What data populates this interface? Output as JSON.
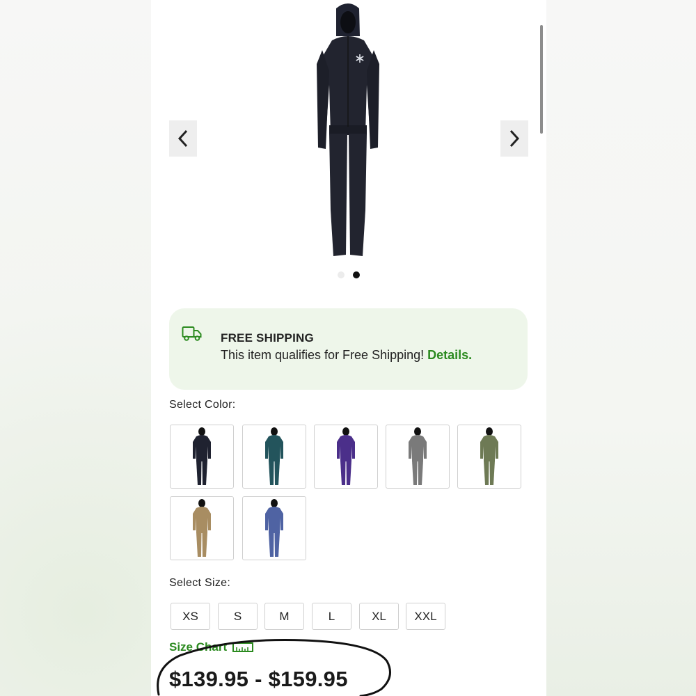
{
  "shipping": {
    "title": "FREE SHIPPING",
    "message": "This item qualifies for Free Shipping!",
    "details_link": "Details."
  },
  "carousel": {
    "slide_count": 2,
    "active_slide": 2
  },
  "color_picker": {
    "label": "Select Color:",
    "swatches": [
      {
        "name": "black",
        "color": "#1f2230"
      },
      {
        "name": "teal",
        "color": "#23545c"
      },
      {
        "name": "purple",
        "color": "#4b2f8a"
      },
      {
        "name": "grey-pattern",
        "color": "#7a7a7a"
      },
      {
        "name": "green-camo",
        "color": "#6e7a55"
      },
      {
        "name": "tan-camo",
        "color": "#a88d62"
      },
      {
        "name": "blue-pattern",
        "color": "#4f63a3"
      }
    ]
  },
  "size_picker": {
    "label": "Select Size:",
    "sizes": [
      "XS",
      "S",
      "M",
      "L",
      "XL",
      "XXL"
    ]
  },
  "size_chart": {
    "label": "Size Chart",
    "icon": "ruler-icon"
  },
  "price": {
    "range": "$139.95 - $159.95"
  },
  "colors": {
    "accent": "#2b8a1f",
    "shipping_bg": "#eef6ea",
    "suit": "#22242f"
  }
}
